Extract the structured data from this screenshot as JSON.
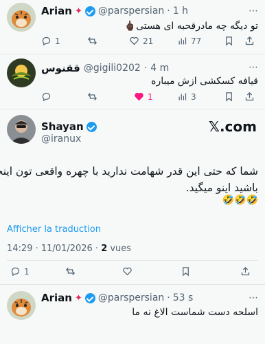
{
  "reply1": {
    "name": "Arian",
    "handle": "@parspersian",
    "dot": "·",
    "time": "1 h",
    "text": "تو دیگه چه مادرقحبه ای هستی🖕🏿",
    "replies": "1",
    "likes": "21",
    "views": "77"
  },
  "reply2": {
    "name": "ققنوس",
    "handle": "@gigili0202",
    "dot": "·",
    "time": "4 m",
    "text": "قیافه کسکشی ازش میباره",
    "likes": "1",
    "views": "3"
  },
  "main_post": {
    "name": "Shayan",
    "handle": "@iranux",
    "brand": "𝕏.com",
    "text_line1": "شما که حتی این قدر شهامت ندارید با چهره واقعی تون اینجا",
    "text_line2": "باشید اینو میگید.",
    "emojis": "🤣🤣🤣",
    "translate": "Afficher la traduction",
    "timestamp": "14:29 · 11/01/2026 · ",
    "views_count": "2",
    "views_label": " vues",
    "replies": "1"
  },
  "reply3": {
    "name": "Arian",
    "handle": "@parspersian",
    "dot": "·",
    "time": "53 s",
    "text": "اسلحه دست شماست الاغ نه ما"
  },
  "colors": {
    "background": "#f7f9f9",
    "text": "#0f1419",
    "secondary": "#536471",
    "accent": "#1d9bf0",
    "liked": "#f91880"
  },
  "icons": [
    "reply-icon",
    "retweet-icon",
    "like-icon",
    "views-icon",
    "bookmark-icon",
    "share-icon",
    "verified-icon",
    "fire-icon",
    "x-logo"
  ]
}
